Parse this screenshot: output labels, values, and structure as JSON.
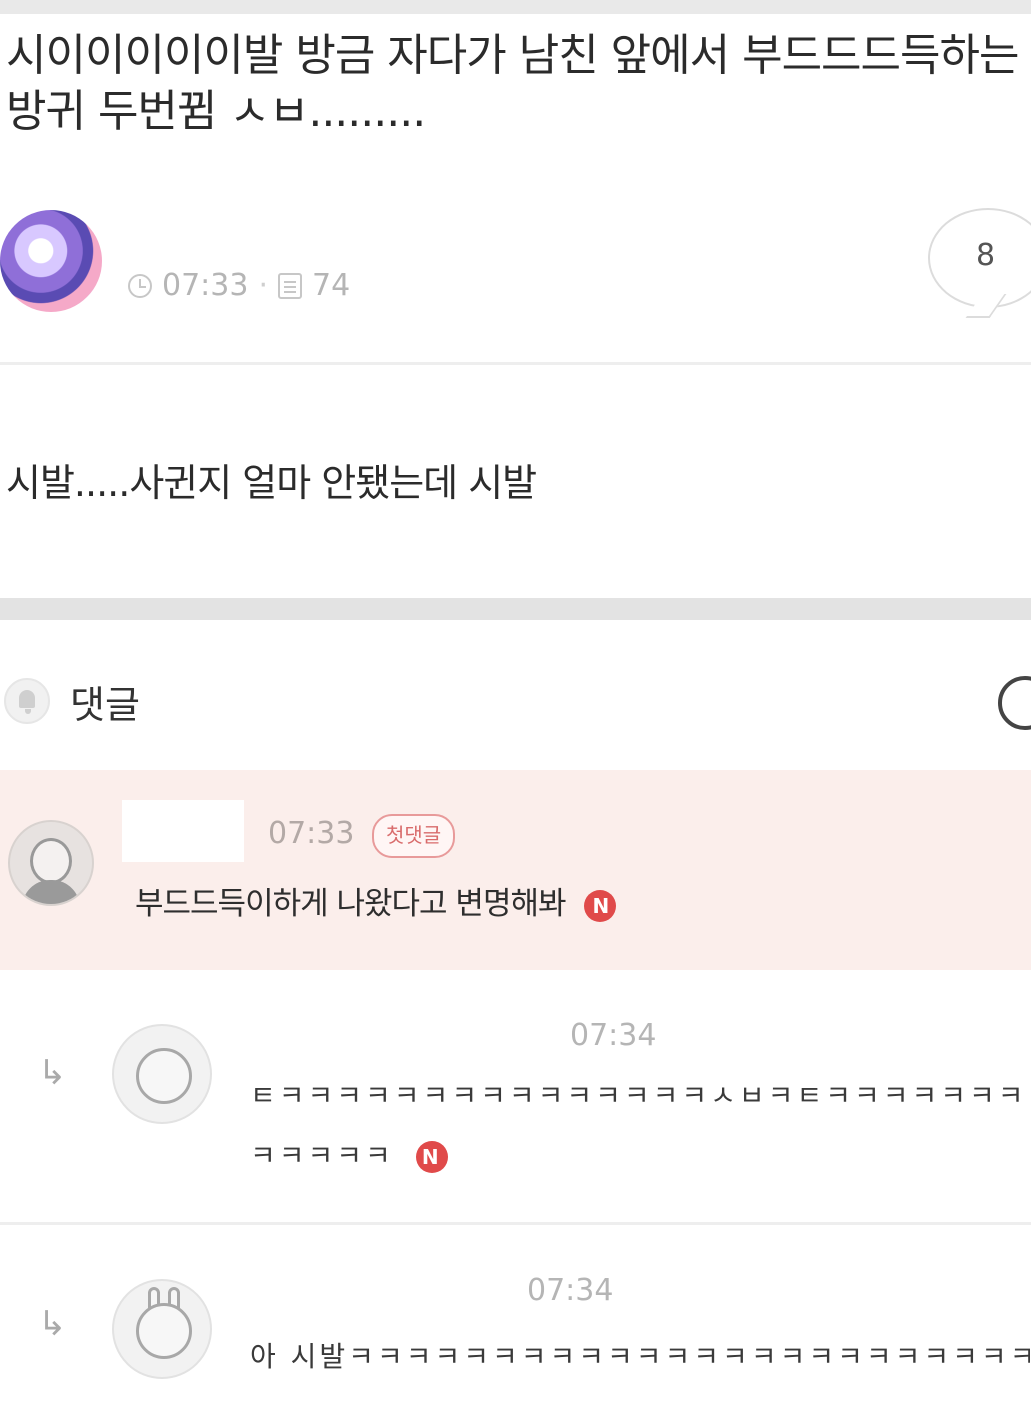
{
  "post": {
    "title": "시이이이이이발 방금 자다가 남친 앞에서 부드드드득하는 방귀 두번뀜 ㅅㅂ.........",
    "time": "07:33",
    "views": "74",
    "comment_count": "8",
    "body": "시발.....사귄지 얼마 안됐는데 시발"
  },
  "comments_section": {
    "label": "댓글"
  },
  "comments": [
    {
      "time": "07:33",
      "badge": "첫댓글",
      "text": "부드드득이하게 나왔다고 변명해봐",
      "new_mark": "N"
    }
  ],
  "replies": [
    {
      "time": "07:34",
      "text": "ㅌㅋㅋㅋㅋㅋㅋㅋㅋㅋㅋㅋㅋㅋㅋㅋㅅㅂㅋㅌㅋㅋㅋㅋㅋㅋㅋㅋㅋㅋㅋㅋ",
      "new_mark": "N"
    },
    {
      "time": "07:34",
      "text": "아 시발ㅋㅋㅋㅋㅋㅋㅋㅋㅋㅋㅋㅋㅋㅋㅋㅋㅋㅋㅋㅋㅋㅋㅋㅋㅋ"
    }
  ]
}
